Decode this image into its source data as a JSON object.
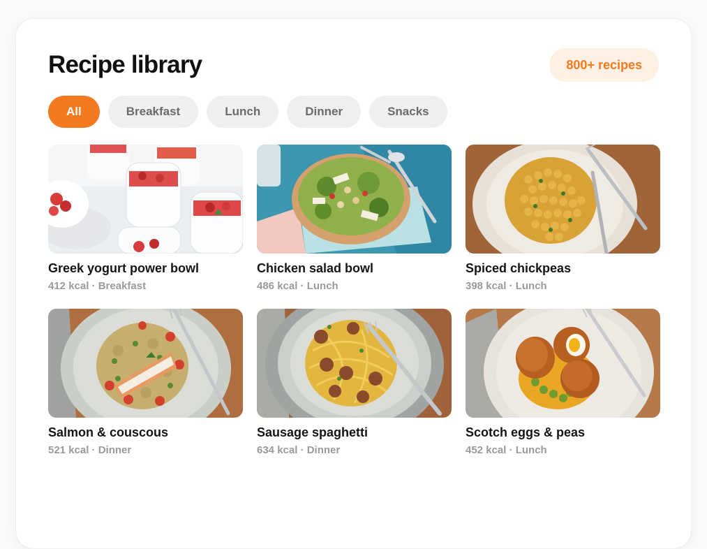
{
  "header": {
    "title": "Recipe library",
    "badge": "800+ recipes"
  },
  "filters": [
    {
      "label": "All",
      "active": true
    },
    {
      "label": "Breakfast",
      "active": false
    },
    {
      "label": "Lunch",
      "active": false
    },
    {
      "label": "Dinner",
      "active": false
    },
    {
      "label": "Snacks",
      "active": false
    }
  ],
  "recipes": [
    {
      "name": "Greek yogurt power bowl",
      "meta": "412 kcal · Breakfast",
      "image": "yogurt-parfait-photo"
    },
    {
      "name": "Chicken salad bowl",
      "meta": "486 kcal · Lunch",
      "image": "chicken-salad-photo"
    },
    {
      "name": "Spiced chickpeas",
      "meta": "398 kcal · Lunch",
      "image": "chickpeas-photo"
    },
    {
      "name": "Salmon & couscous",
      "meta": "521 kcal · Dinner",
      "image": "salmon-couscous-photo"
    },
    {
      "name": "Sausage spaghetti",
      "meta": "634 kcal · Dinner",
      "image": "sausage-spaghetti-photo"
    },
    {
      "name": "Scotch eggs & peas",
      "meta": "452 kcal · Lunch",
      "image": "scotch-eggs-photo"
    }
  ],
  "colors": {
    "accent": "#f47a20",
    "badge_bg": "#fff0e4",
    "chip_bg": "#efefef",
    "chip_text": "#6b6b6b",
    "meta_text": "#9a9a9a"
  }
}
